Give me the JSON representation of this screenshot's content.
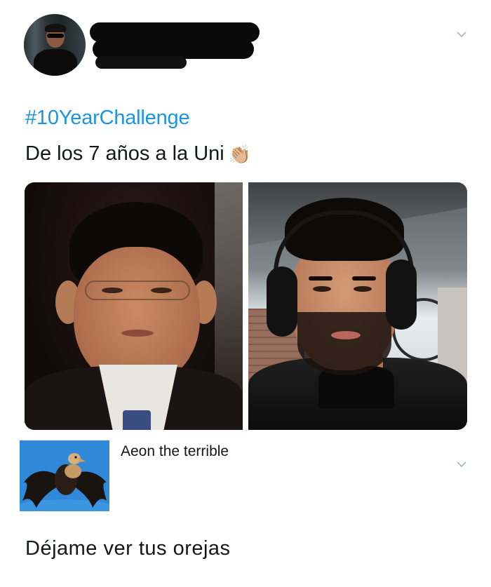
{
  "tweet": {
    "hashtag": "#10YearChallenge",
    "text": "De los 7 años a la Uni",
    "emoji": "👏🏼",
    "images": [
      {
        "alt_name": "child-photo"
      },
      {
        "alt_name": "adult-photo"
      }
    ]
  },
  "reply": {
    "author_name": "Aeon the terrible",
    "text": "Déjame ver tus orejas"
  },
  "colors": {
    "hashtag": "#1b95e0",
    "text": "#14171a",
    "chevron": "#aab8c2",
    "reply_avatar_bg": "#2f88d8"
  },
  "icons": {
    "tweet_menu": "chevron-down-icon",
    "reply_menu": "chevron-down-icon",
    "emoji": "clapping-hands-icon"
  }
}
